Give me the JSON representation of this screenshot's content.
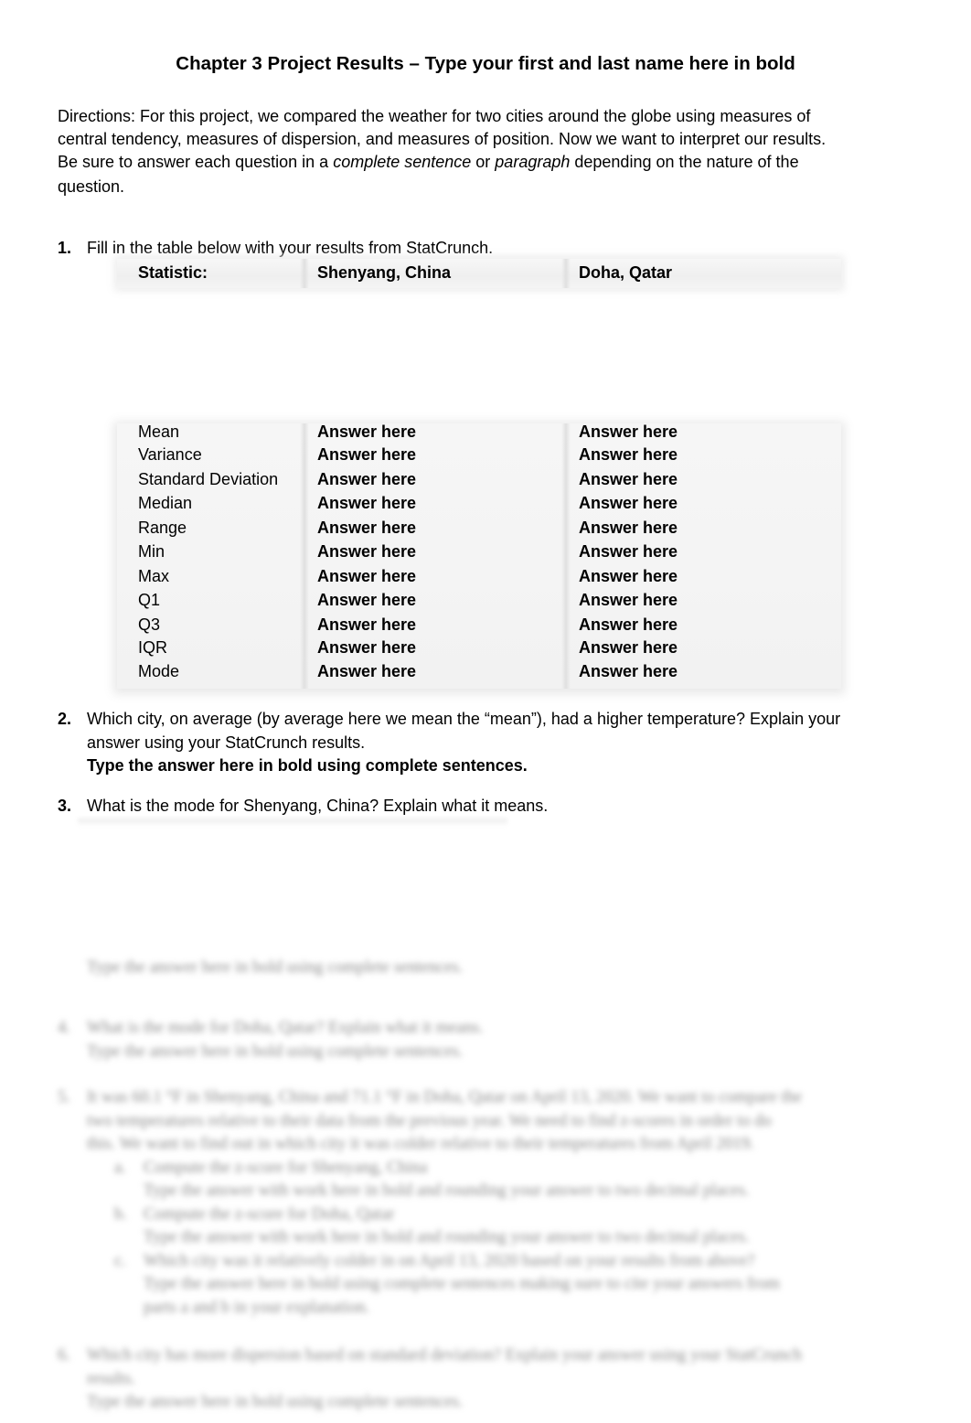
{
  "document": {
    "title": "Chapter 3 Project Results – Type your first and last name here in bold",
    "directions": {
      "line1": "Directions: For this project, we compared the weather for two cities around the globe using measures of",
      "line2": "central tendency, measures of dispersion, and measures of position. Now we want to interpret our results.",
      "line3_pre": "Be sure to answer each question in a ",
      "line3_em1": "complete sentence",
      "line3_mid": " or ",
      "line3_em2": "paragraph",
      "line3_post": " depending on the nature of the",
      "line4": "question."
    },
    "questions": [
      {
        "number": "1.",
        "text": "Fill in the table below with your results from StatCrunch."
      },
      {
        "number": "2.",
        "line1": "Which city, on average (by average here we mean the “mean”), had a higher temperature? Explain your",
        "line2": "answer using your StatCrunch results.",
        "answer_prompt": "Type the answer here in bold using complete sentences."
      },
      {
        "number": "3.",
        "text": "What is the mode for Shenyang, China? Explain what it means."
      }
    ],
    "table": {
      "headers": [
        "Statistic:",
        "Shenyang, China",
        "Doha, Qatar"
      ],
      "rows": [
        {
          "statistic": "Mean",
          "shenyang": "Answer here",
          "doha": "Answer here"
        },
        {
          "statistic": "Variance",
          "shenyang": "Answer here",
          "doha": "Answer here"
        },
        {
          "statistic": "Standard Deviation",
          "shenyang": "Answer here",
          "doha": "Answer here"
        },
        {
          "statistic": "Median",
          "shenyang": "Answer here",
          "doha": "Answer here"
        },
        {
          "statistic": "Range",
          "shenyang": "Answer here",
          "doha": "Answer here"
        },
        {
          "statistic": "Min",
          "shenyang": "Answer here",
          "doha": "Answer here"
        },
        {
          "statistic": "Max",
          "shenyang": "Answer here",
          "doha": "Answer here"
        },
        {
          "statistic": "Q1",
          "shenyang": "Answer here",
          "doha": "Answer here"
        },
        {
          "statistic": "Q3",
          "shenyang": "Answer here",
          "doha": "Answer here"
        },
        {
          "statistic": "IQR",
          "shenyang": "Answer here",
          "doha": "Answer here"
        },
        {
          "statistic": "Mode",
          "shenyang": "Answer here",
          "doha": "Answer here"
        }
      ]
    },
    "blurred": {
      "q3_answer": "Type the answer here in bold using complete sentences.",
      "q4_number": "4.",
      "q4_line1": "What is the mode for Doha, Qatar? Explain what it means.",
      "q4_answer": "Type the answer here in bold using complete sentences.",
      "q5_number": "5.",
      "q5_line1": "It was 60.1 °F in Shenyang, China and 71.1 °F in Doha, Qatar on April 13, 2020. We want to compare the",
      "q5_line2": "two temperatures relative to their data from the previous year. We need to find z-scores in order to do",
      "q5_line3": "this. We want to find out in which city it was colder relative to their temperatures from April 2019.",
      "q5_subs": [
        {
          "label": "a.",
          "line1": "Compute the z-score for Shenyang, China",
          "line2": "Type the answer with work here in bold and rounding your answer to two decimal places."
        },
        {
          "label": "b.",
          "line1": "Compute the z-score for Doha, Qatar",
          "line2": "Type the answer with work here in bold and rounding your answer to two decimal places."
        },
        {
          "label": "c.",
          "line1": "Which city was it relatively colder in on April 13, 2020 based on your results from above?",
          "line2": "Type the answer here in bold using complete sentences making sure to cite your answers from",
          "line3": "parts a and b in your explanation."
        }
      ],
      "q6_number": "6.",
      "q6_line1": "Which city has more dispersion based on standard deviation? Explain your answer using your StatCrunch",
      "q6_line2": "results.",
      "q6_answer": "Type the answer here in bold using complete sentences."
    }
  }
}
